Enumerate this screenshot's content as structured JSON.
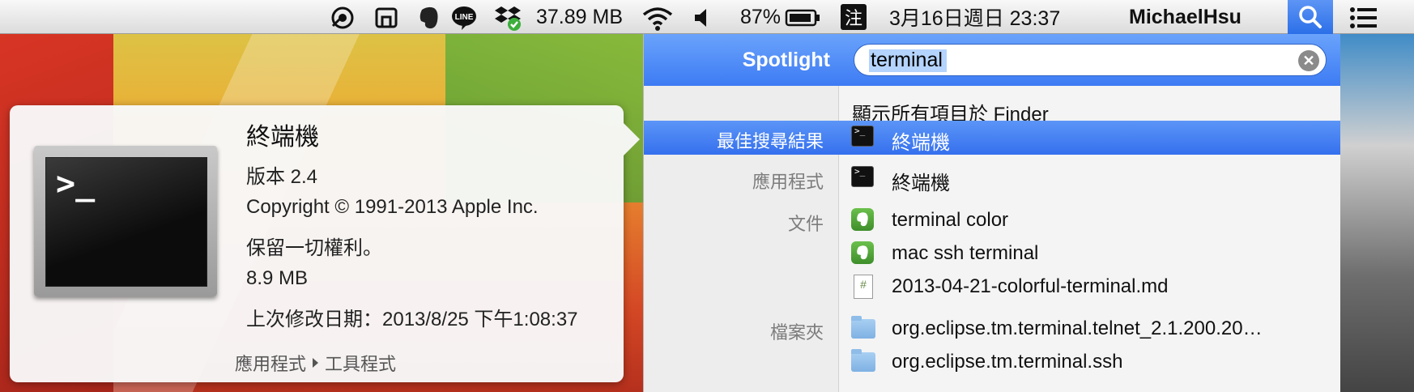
{
  "menubar": {
    "storage": "37.89 MB",
    "battery_percent": "87%",
    "input_method": "注",
    "datetime": "3月16日週日  23:37",
    "user": "MichaelHsu",
    "line_label": "LINE"
  },
  "spotlight": {
    "title": "Spotlight",
    "query": "terminal",
    "show_all": "顯示所有項目於 Finder",
    "rows": [
      {
        "category": "最佳搜尋結果",
        "label": "終端機"
      },
      {
        "category": "應用程式",
        "label": "終端機"
      },
      {
        "category": "文件",
        "label": "terminal color"
      },
      {
        "category": "",
        "label": "mac ssh terminal"
      },
      {
        "category": "",
        "label": "2013-04-21-colorful-terminal.md"
      },
      {
        "category": "檔案夾",
        "label": "org.eclipse.tm.terminal.telnet_2.1.200.20…"
      },
      {
        "category": "",
        "label": "org.eclipse.tm.terminal.ssh"
      }
    ]
  },
  "preview": {
    "title": "終端機",
    "version": "版本 2.4",
    "copyright": "Copyright © 1991-2013 Apple Inc.",
    "rights": "保留一切權利。",
    "size": "8.9 MB",
    "modified": "上次修改日期：2013/8/25 下午1:08:37",
    "path": [
      "應用程式",
      "工具程式"
    ],
    "prompt_glyph": ">_"
  }
}
